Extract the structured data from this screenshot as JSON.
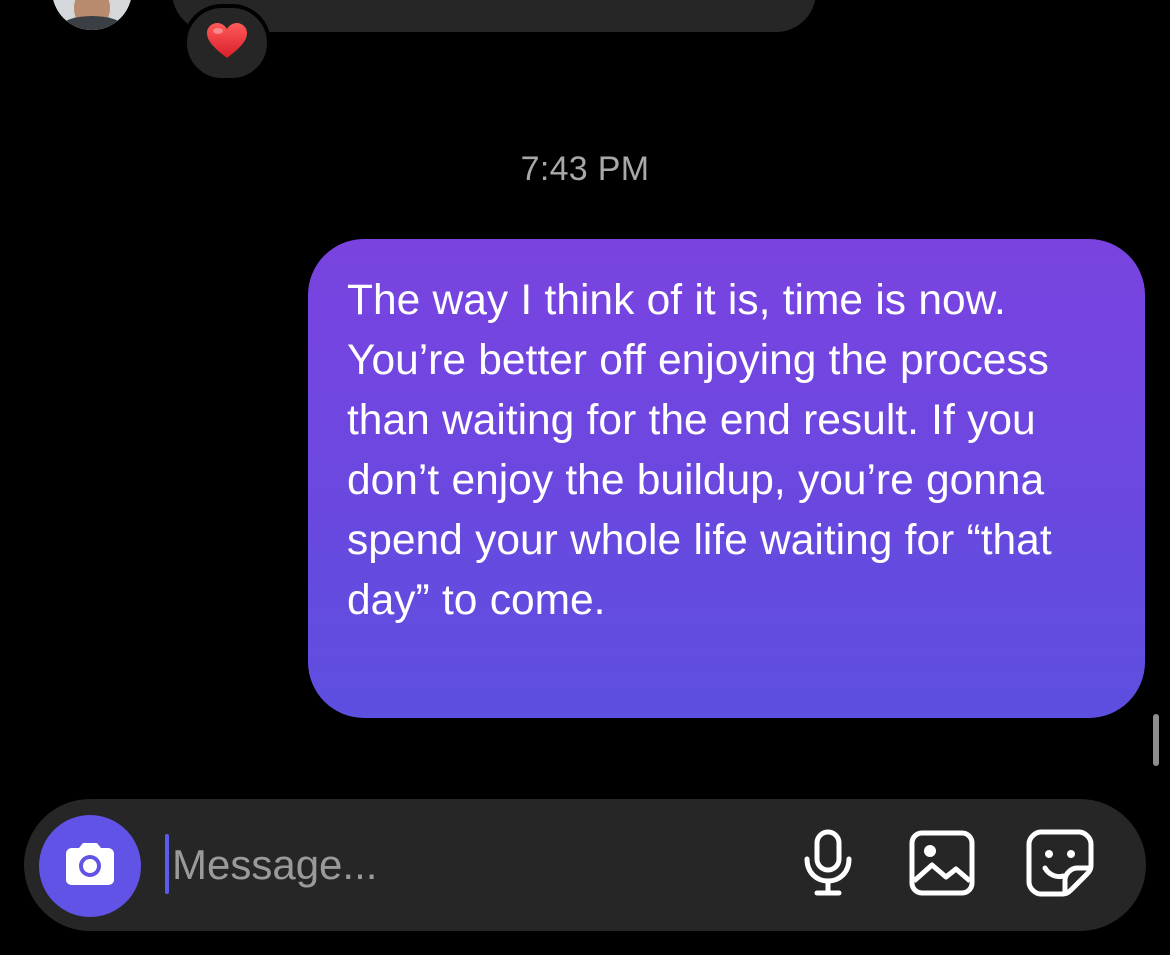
{
  "conversation": {
    "reaction_emoji": "❤️",
    "timestamp": "7:43 PM",
    "outgoing_message": "The way I think of it is, time is now. You’re better off enjoying the process than waiting for the end result. If you don’t enjoy the buildup, you’re gonna spend your whole life waiting for “that day” to come."
  },
  "composer": {
    "placeholder": "Message...",
    "value": "",
    "icons": {
      "camera": "camera-icon",
      "mic": "microphone-icon",
      "gallery": "image-gallery-icon",
      "sticker": "sticker-icon"
    }
  },
  "colors": {
    "background": "#000000",
    "incoming_bubble": "#262626",
    "outgoing_gradient_top": "#7a43e0",
    "outgoing_gradient_bottom": "#5d4fe0",
    "accent": "#6153e6",
    "timestamp_text": "#a8a8a8"
  }
}
